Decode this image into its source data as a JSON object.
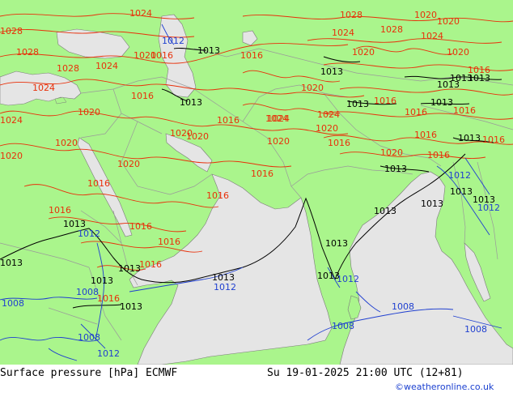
{
  "title": "Surface pressure [hPa] ECMWF",
  "valid_time": "Su 19-01-2025 21:00 UTC (12+81)",
  "credit": "©weatheronline.co.uk",
  "colors": {
    "land": "#aaf58c",
    "sea": "#e5e5e5",
    "border": "#9a9a9a",
    "isobar_high": "#e8300a",
    "isobar_mid": "#000000",
    "isobar_low": "#1f3fd0"
  },
  "isobar_labels": {
    "high": [
      "1028",
      "1028",
      "1024",
      "1020",
      "1024",
      "1028",
      "1024",
      "1020",
      "1016",
      "1016",
      "1020",
      "1024",
      "1028",
      "1020",
      "1020",
      "1024",
      "1020",
      "1024",
      "1020",
      "1020",
      "1020",
      "1016",
      "1020",
      "1020",
      "1016",
      "1016",
      "1016",
      "1016",
      "1016",
      "1016",
      "1016",
      "1016",
      "1016",
      "1016",
      "1020",
      "1024",
      "1024",
      "1028",
      "1020",
      "1020",
      "1024",
      "1020",
      "1016",
      "1016",
      "1016",
      "1016",
      "1016",
      "1016",
      "1016"
    ],
    "mid": [
      "1013",
      "1013",
      "1013",
      "1013",
      "1013",
      "1013",
      "1013",
      "1013",
      "1013",
      "1013",
      "1013",
      "1013",
      "1013",
      "1013",
      "1013",
      "1013",
      "1013",
      "1013",
      "1013",
      "1013",
      "1013",
      "1013"
    ],
    "low": [
      "1012",
      "1012",
      "1012",
      "1012",
      "1012",
      "1008",
      "1008",
      "1008",
      "1008",
      "1008",
      "1008",
      "1012",
      "1012"
    ]
  }
}
